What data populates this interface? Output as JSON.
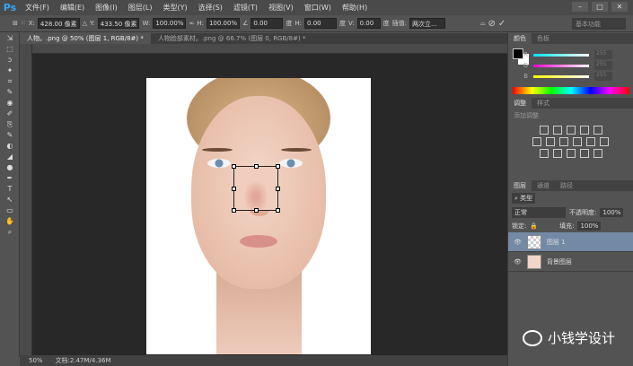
{
  "app": {
    "logo": "Ps",
    "menus": [
      "文件(F)",
      "编辑(E)",
      "图像(I)",
      "图层(L)",
      "类型(Y)",
      "选择(S)",
      "滤镜(T)",
      "视图(V)",
      "窗口(W)",
      "帮助(H)"
    ],
    "window_buttons": [
      "–",
      "□",
      "✕"
    ]
  },
  "options": {
    "x_label": "X:",
    "x": "428.00 像素",
    "y_label": "Y:",
    "y": "433.50 像素",
    "w_label": "W:",
    "w": "100.00%",
    "h_label": "H:",
    "h": "100.00%",
    "angle": "0.00",
    "deg": "度",
    "hskew_label": "H:",
    "hskew": "0.00",
    "vskew_label": "V:",
    "vskew": "0.00",
    "interp_label": "插值:",
    "interp": "两次立...",
    "workspace": "基本功能"
  },
  "tabs": [
    {
      "label": "人物。.png @ 50% (图层 1, RGB/8#) *",
      "active": true
    },
    {
      "label": "人物脸部素材。.png @ 66.7% (图层 0, RGB/8#) *",
      "active": false
    }
  ],
  "color_panel": {
    "tabs": [
      "颜色",
      "色板"
    ],
    "channels": [
      {
        "label": "R",
        "value": "255",
        "color": "#00e5ff"
      },
      {
        "label": "G",
        "value": "255",
        "color": "#ff00d0"
      },
      {
        "label": "B",
        "value": "255",
        "color": "#ffff00"
      }
    ]
  },
  "adjust_panel": {
    "tabs": [
      "调整",
      "样式"
    ],
    "title": "添加调整"
  },
  "layers_panel": {
    "tabs": [
      "图层",
      "通道",
      "路径"
    ],
    "filter": "类型",
    "blend": "正常",
    "opacity_label": "不透明度:",
    "opacity": "100%",
    "lock_label": "锁定:",
    "fill_label": "填充:",
    "fill": "100%",
    "layers": [
      {
        "name": "图层 1",
        "selected": true
      },
      {
        "name": "背景图层",
        "selected": false
      }
    ]
  },
  "status": {
    "zoom": "50%",
    "doc": "文档:2.47M/4.36M"
  },
  "watermark": "小钱学设计"
}
